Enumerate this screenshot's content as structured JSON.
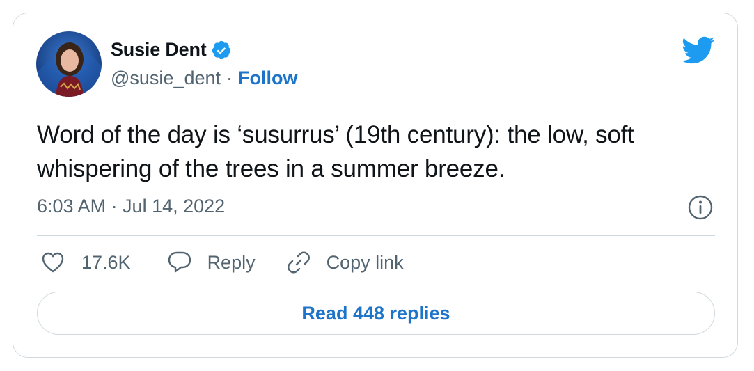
{
  "author": {
    "name": "Susie Dent",
    "handle": "@susie_dent",
    "separator": "·",
    "follow_label": "Follow",
    "verified_icon": "verified-badge-icon"
  },
  "tweet": {
    "text": "Word of the day is ‘susurrus’ (19th century): the low, soft whispering of the trees in a summer breeze.",
    "timestamp": "6:03 AM · Jul 14, 2022"
  },
  "actions": {
    "like_count": "17.6K",
    "reply_label": "Reply",
    "copy_link_label": "Copy link"
  },
  "read_replies_label": "Read 448 replies",
  "icons": {
    "brand": "twitter-bird-icon",
    "info": "info-icon",
    "like": "heart-icon",
    "reply": "speech-bubble-icon",
    "copy": "link-icon"
  },
  "colors": {
    "accent": "#1d74c8",
    "twitter_blue": "#1d9bf0",
    "muted_text": "#536471",
    "border": "#cfd9de",
    "text": "#0f1419"
  }
}
